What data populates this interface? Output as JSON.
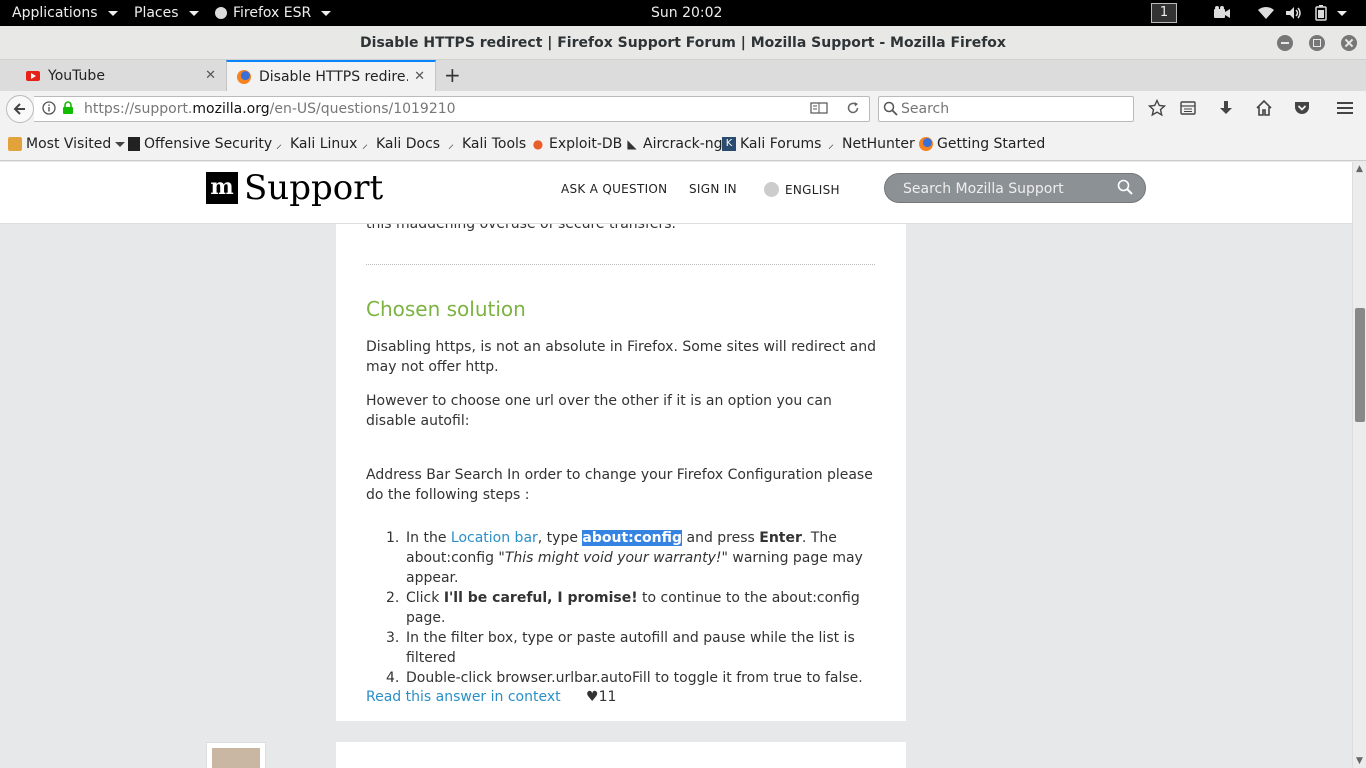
{
  "topbar": {
    "applications": "Applications",
    "places": "Places",
    "app_name": "Firefox ESR",
    "clock": "Sun 20:02",
    "workspace": "1"
  },
  "window": {
    "title": "Disable HTTPS redirect | Firefox Support Forum | Mozilla Support - Mozilla Firefox"
  },
  "tabs": [
    {
      "label": "YouTube",
      "icon": "youtube-icon"
    },
    {
      "label": "Disable HTTPS redire…",
      "icon": "firefox-icon"
    }
  ],
  "navbar": {
    "url_prefix": "https://support.",
    "url_domain": "mozilla.org",
    "url_path": "/en-US/questions/1019210",
    "search_placeholder": "Search"
  },
  "bookmarks": [
    {
      "label": "Most Visited",
      "icon": "folder-icon"
    },
    {
      "label": "Offensive Security",
      "icon": "offsec-icon"
    },
    {
      "label": "Kali Linux",
      "icon": "kali-icon"
    },
    {
      "label": "Kali Docs",
      "icon": "kali-icon"
    },
    {
      "label": "Kali Tools",
      "icon": "kali-icon"
    },
    {
      "label": "Exploit-DB",
      "icon": "exploitdb-icon"
    },
    {
      "label": "Aircrack-ng",
      "icon": "aircrack-icon"
    },
    {
      "label": "Kali Forums",
      "icon": "kali-forums-icon"
    },
    {
      "label": "NetHunter",
      "icon": "kali-icon"
    },
    {
      "label": "Getting Started",
      "icon": "firefox-icon"
    }
  ],
  "site": {
    "logo_mark": "m",
    "logo_text": "Support",
    "nav": {
      "ask": "ASK A QUESTION",
      "signin": "SIGN IN",
      "language": "ENGLISH"
    },
    "search_placeholder": "Search Mozilla Support"
  },
  "answer": {
    "prev_text": "this maddening overuse of secure transfers.",
    "heading": "Chosen solution",
    "p1": "Disabling https, is not an absolute in Firefox. Some sites will redirect and may not offer http.",
    "p2": "However to choose one url over the other if it is an option you can disable autofil:",
    "p3": "Address Bar Search In order to change your Firefox Configuration please do the following steps :",
    "steps": {
      "s1": {
        "num": "1.",
        "a": "In the ",
        "link": "Location bar",
        "b": ", type ",
        "code": "about:config",
        "c": " and press ",
        "key": "Enter",
        "d": ". The about:config \"",
        "italic": "This might void your warranty!",
        "e": "\" warning page may appear."
      },
      "s2": {
        "num": "2.",
        "a": "Click ",
        "bold": "I'll be careful, I promise!",
        "b": " to continue to the about:config page."
      },
      "s3": {
        "num": "3.",
        "text": "In the filter box, type or paste autofill and pause while the list is filtered"
      },
      "s4": {
        "num": "4.",
        "text": "Double-click browser.urlbar.autoFill to toggle it from true to false."
      }
    },
    "read_link": "Read this answer in context",
    "votes": "11"
  }
}
